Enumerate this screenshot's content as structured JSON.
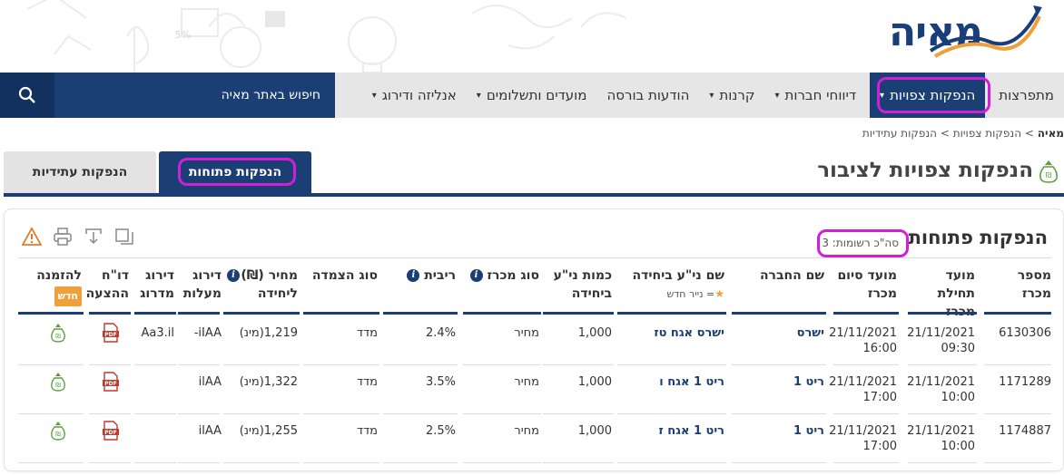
{
  "header": {
    "logo_text": "מאיה",
    "doodle_percent": "5%"
  },
  "nav": {
    "items": [
      {
        "label": "מתפרצות",
        "caret": false,
        "active": false
      },
      {
        "label": "הנפקות צפויות",
        "caret": true,
        "active": true
      },
      {
        "label": "דיווחי חברות",
        "caret": true,
        "active": false
      },
      {
        "label": "קרנות",
        "caret": true,
        "active": false
      },
      {
        "label": "הודעות בורסה",
        "caret": false,
        "active": false
      },
      {
        "label": "מועדים ותשלומים",
        "caret": true,
        "active": false
      },
      {
        "label": "אנליזה ודירוג",
        "caret": true,
        "active": false
      }
    ],
    "search_label": "חיפוש באתר מאיה"
  },
  "breadcrumb": {
    "home": "מאיה",
    "sep": ">",
    "level1": "הנפקות צפויות",
    "level2": "הנפקות עתידיות"
  },
  "page": {
    "title": "הנפקות צפויות לציבור",
    "tab_open": "הנפקות פתוחות",
    "tab_future": "הנפקות עתידיות"
  },
  "panel": {
    "title": "הנפקות פתוחות",
    "records": "סה\"כ רשומות: 3"
  },
  "table": {
    "headers": {
      "tender_number": "מספר מכרז",
      "tender_start": "מועד תחילת מכרז",
      "tender_end": "מועד סיום מכרז",
      "company": "שם החברה",
      "security_name": "שם ני\"ע ביחידה",
      "new_security_note": "= נייר חדש",
      "unit_quantity": "כמות ני\"ע ביחידה",
      "tender_type": "סוג מכרז",
      "interest": "ריבית",
      "linkage": "סוג הצמדה",
      "unit_price": "מחיר (₪) ליחידה",
      "rating_maalot": "דירוג מעלות",
      "rating_midroog": "דירוג מדרוג",
      "prospectus_report": "דו\"ח ההצעה",
      "order": "להזמנה",
      "new_badge": "חדש"
    },
    "rows": [
      {
        "tender_number": "6130306",
        "start_date": "21/11/2021",
        "start_time": "09:30",
        "end_date": "21/11/2021",
        "end_time": "16:00",
        "company": "ישרס",
        "security_name": "ישרס אגח טז",
        "unit_quantity": "1,000",
        "tender_type": "מחיר",
        "interest": "2.4%",
        "linkage": "מדד",
        "unit_price": "1,219(מינ)",
        "rating_maalot": "iIAA-",
        "rating_midroog": "Aa3.il"
      },
      {
        "tender_number": "1171289",
        "start_date": "21/11/2021",
        "start_time": "10:00",
        "end_date": "21/11/2021",
        "end_time": "17:00",
        "company": "ריט 1",
        "security_name": "ריט 1 אגח ו",
        "unit_quantity": "1,000",
        "tender_type": "מחיר",
        "interest": "3.5%",
        "linkage": "מדד",
        "unit_price": "1,322(מינ)",
        "rating_maalot": "ilAA",
        "rating_midroog": ""
      },
      {
        "tender_number": "1174887",
        "start_date": "21/11/2021",
        "start_time": "10:00",
        "end_date": "21/11/2021",
        "end_time": "17:00",
        "company": "ריט 1",
        "security_name": "ריט 1 אגח ז",
        "unit_quantity": "1,000",
        "tender_type": "מחיר",
        "interest": "2.5%",
        "linkage": "מדד",
        "unit_price": "1,255(מינ)",
        "rating_maalot": "ilAA",
        "rating_midroog": ""
      }
    ]
  },
  "colors": {
    "brand_navy": "#1b3f75",
    "highlight": "#d11fd6",
    "accent_orange": "#f0a03a",
    "pdf_red": "#c0392b",
    "bag_green": "#5aa03c"
  }
}
